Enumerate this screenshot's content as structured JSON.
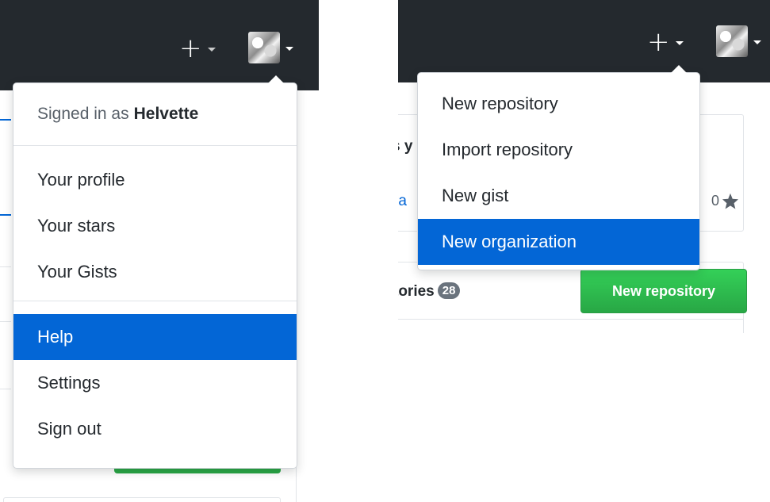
{
  "left_panel": {
    "user_menu": {
      "signed_in_prefix": "Signed in as",
      "username": "Helvette",
      "items_group1": [
        "Your profile",
        "Your stars",
        "Your Gists"
      ],
      "items_group2": [
        "Help",
        "Settings",
        "Sign out"
      ],
      "active_item": "Help"
    }
  },
  "right_panel": {
    "create_menu": {
      "items": [
        "New repository",
        "Import repository",
        "New gist",
        "New organization"
      ],
      "active_item": "New organization"
    },
    "background": {
      "repositories_label": "tories",
      "repositories_count": "28",
      "star_count": "0",
      "new_repository_button": "New repository",
      "partial_text_1": "s y",
      "partial_text_2": "ra"
    }
  },
  "colors": {
    "header_bg": "#24292e",
    "active_bg": "#0366d6",
    "button_green": "#28a745"
  }
}
